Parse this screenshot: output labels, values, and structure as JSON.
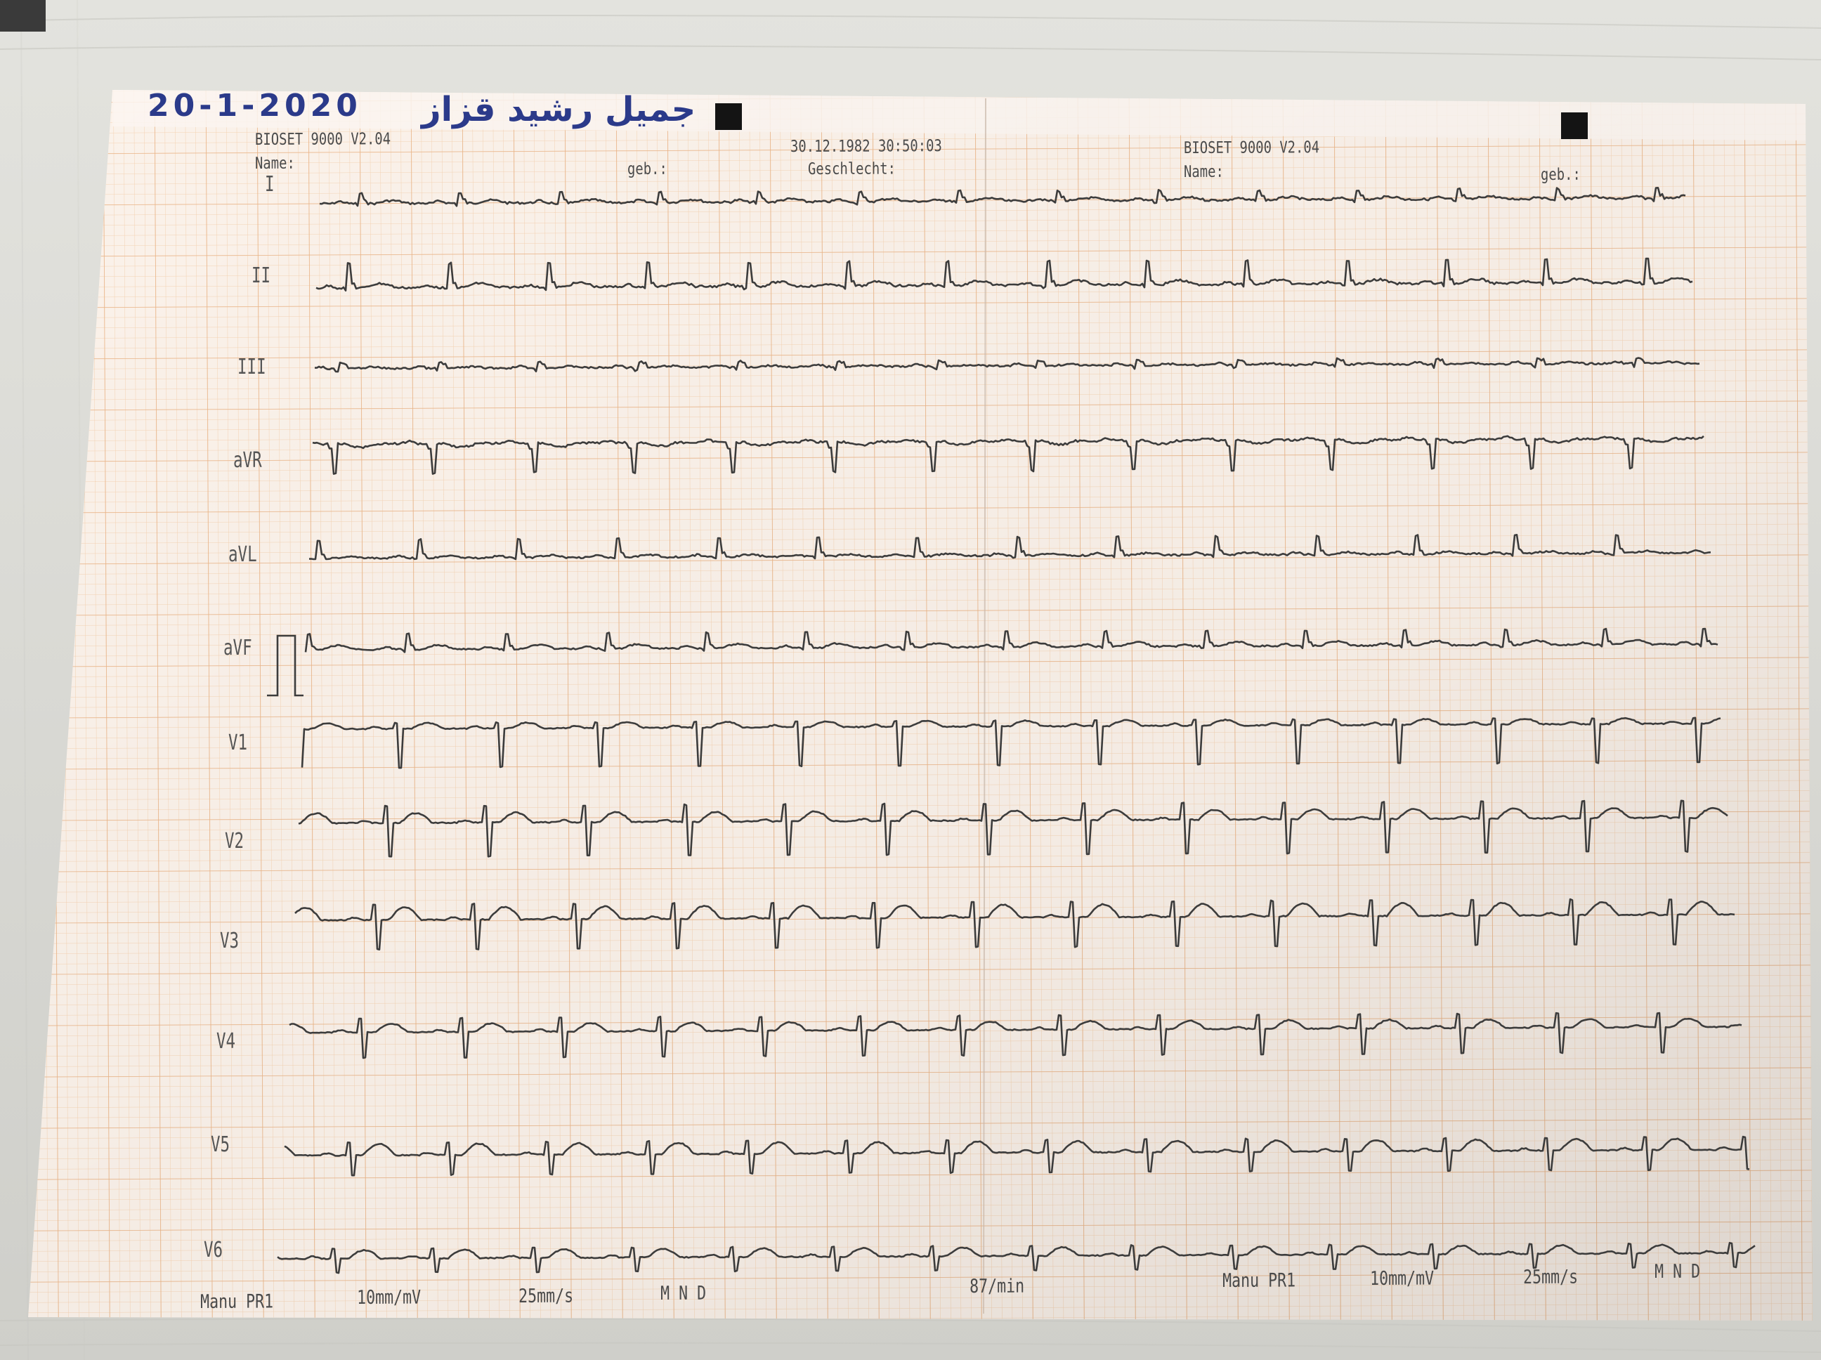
{
  "handwriting": {
    "date": "20-1-2020",
    "patient_name": "جميل رشيد قزاز"
  },
  "header": {
    "left_device": "BIOSET 9000 V2.04",
    "left_name_label": "Name:",
    "left_birth_label": "geb.:",
    "datetime": "30.12.1982 30:50:03",
    "sex_label": "Geschlecht:",
    "right_device": "BIOSET 9000 V2.04",
    "right_name_label": "Name:",
    "right_birth_label": "geb.:"
  },
  "leads": [
    "I",
    "II",
    "III",
    "aVR",
    "aVL",
    "aVF",
    "V1",
    "V2",
    "V3",
    "V4",
    "V5",
    "V6"
  ],
  "footer": {
    "left_mode": "Manu PR1",
    "left_gain": "10mm/mV",
    "left_speed": "25mm/s",
    "left_filters": "M  N  D",
    "heart_rate": "87/min",
    "right_mode": "Manu PR1",
    "right_gain": "10mm/mV",
    "right_speed": "25mm/s",
    "right_filters": "M  N  D"
  },
  "colors": {
    "paper": "#fbf2ea",
    "grid_minor": "#f4d2b2",
    "grid_major": "#eab487",
    "trace": "#3c3c3c",
    "handwriting_ink": "#2b3a8a",
    "desk": "#dcdcd6"
  }
}
